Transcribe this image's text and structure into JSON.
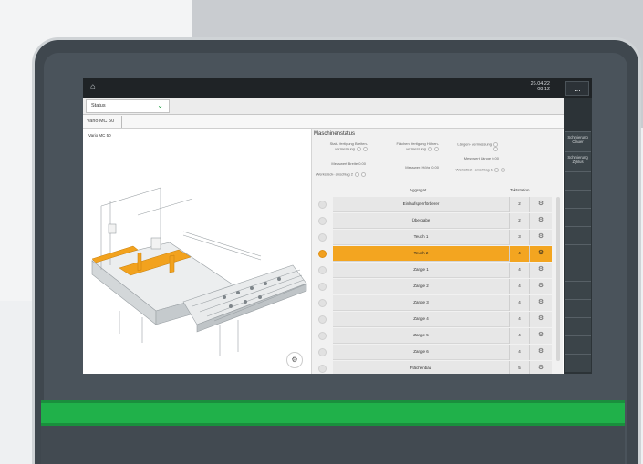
{
  "topbar": {
    "date": "26.04.22",
    "time": "08:12",
    "menu_label": "..."
  },
  "status_dropdown": {
    "value": "Status"
  },
  "tab": {
    "label": "Vario MC 50"
  },
  "machine_title": "Vario MC 50",
  "right_panel": {
    "buttons": [
      "Schmierung Clauer",
      "Schmierung Zyklus"
    ]
  },
  "machine_status": {
    "title": "Maschinenstatus",
    "items": [
      {
        "label": "Stab- fertigung Breiten- vermessung",
        "value": ""
      },
      {
        "label": "Flächen- fertigung Höhen- vermessung",
        "value": ""
      },
      {
        "label": "Längen- vermessung",
        "value": ""
      },
      {
        "label": "Messwert Breite",
        "value": "0.00"
      },
      {
        "label": "Messwert Höhe",
        "value": "0.00"
      },
      {
        "label": "Messwert Länge",
        "value": "0.00"
      },
      {
        "label": "Werkstück- anschlag 2",
        "value": ""
      },
      {
        "label": "Werkstück- anschlag 1",
        "value": ""
      }
    ]
  },
  "table": {
    "headers": [
      "Aggregat",
      "Taktstation"
    ],
    "rows": [
      {
        "name": "Einlaufsperrförderer",
        "value": "2",
        "active": false
      },
      {
        "name": "Übergabe",
        "value": "2",
        "active": false
      },
      {
        "name": "Teuch 1",
        "value": "3",
        "active": false
      },
      {
        "name": "Teuch 2",
        "value": "4",
        "active": true
      },
      {
        "name": "Zange 1",
        "value": "4",
        "active": false
      },
      {
        "name": "Zange 2",
        "value": "4",
        "active": false
      },
      {
        "name": "Zange 3",
        "value": "4",
        "active": false
      },
      {
        "name": "Zange 4",
        "value": "4",
        "active": false
      },
      {
        "name": "Zange 5",
        "value": "4",
        "active": false
      },
      {
        "name": "Zange 6",
        "value": "4",
        "active": false
      },
      {
        "name": "Flächenbau",
        "value": "5",
        "active": false
      }
    ]
  },
  "colors": {
    "accent": "#f3a520",
    "brand_green": "#20b14a",
    "dropdown_chevron": "#22a145"
  },
  "icons": {
    "home": "home-icon",
    "tool": "tool-icon",
    "chevron": "chevron-down-icon"
  }
}
